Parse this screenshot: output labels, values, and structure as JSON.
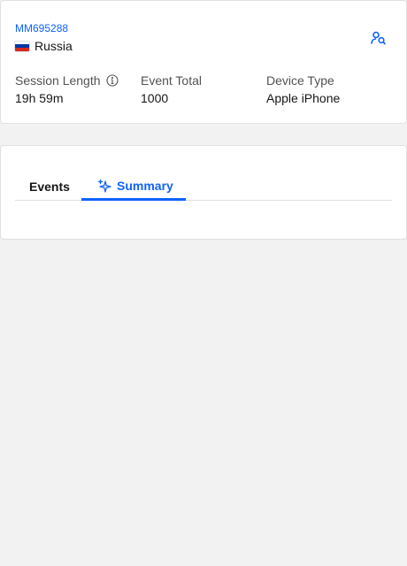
{
  "session": {
    "id": "MM695288",
    "country": "Russia",
    "stats": [
      {
        "label": "Session Length",
        "value": "19h 59m"
      },
      {
        "label": "Event Total",
        "value": "1000"
      },
      {
        "label": "Device Type",
        "value": "Apple iPhone"
      }
    ]
  },
  "tabs": {
    "events_label": "Events",
    "summary_label": "Summary",
    "active": "Summary"
  },
  "icons": {
    "user_search": "user-search-icon",
    "info": "info-icon",
    "sparkle": "ai-sparkle-icon",
    "flag": "russia-flag-icon"
  },
  "colors": {
    "accent": "#0f62fe",
    "background": "#f2f2f2",
    "card": "#ffffff",
    "text": "#161616",
    "muted": "#525252",
    "flag_white": "#ffffff",
    "flag_blue": "#0039a6",
    "flag_red": "#d52b1e"
  }
}
